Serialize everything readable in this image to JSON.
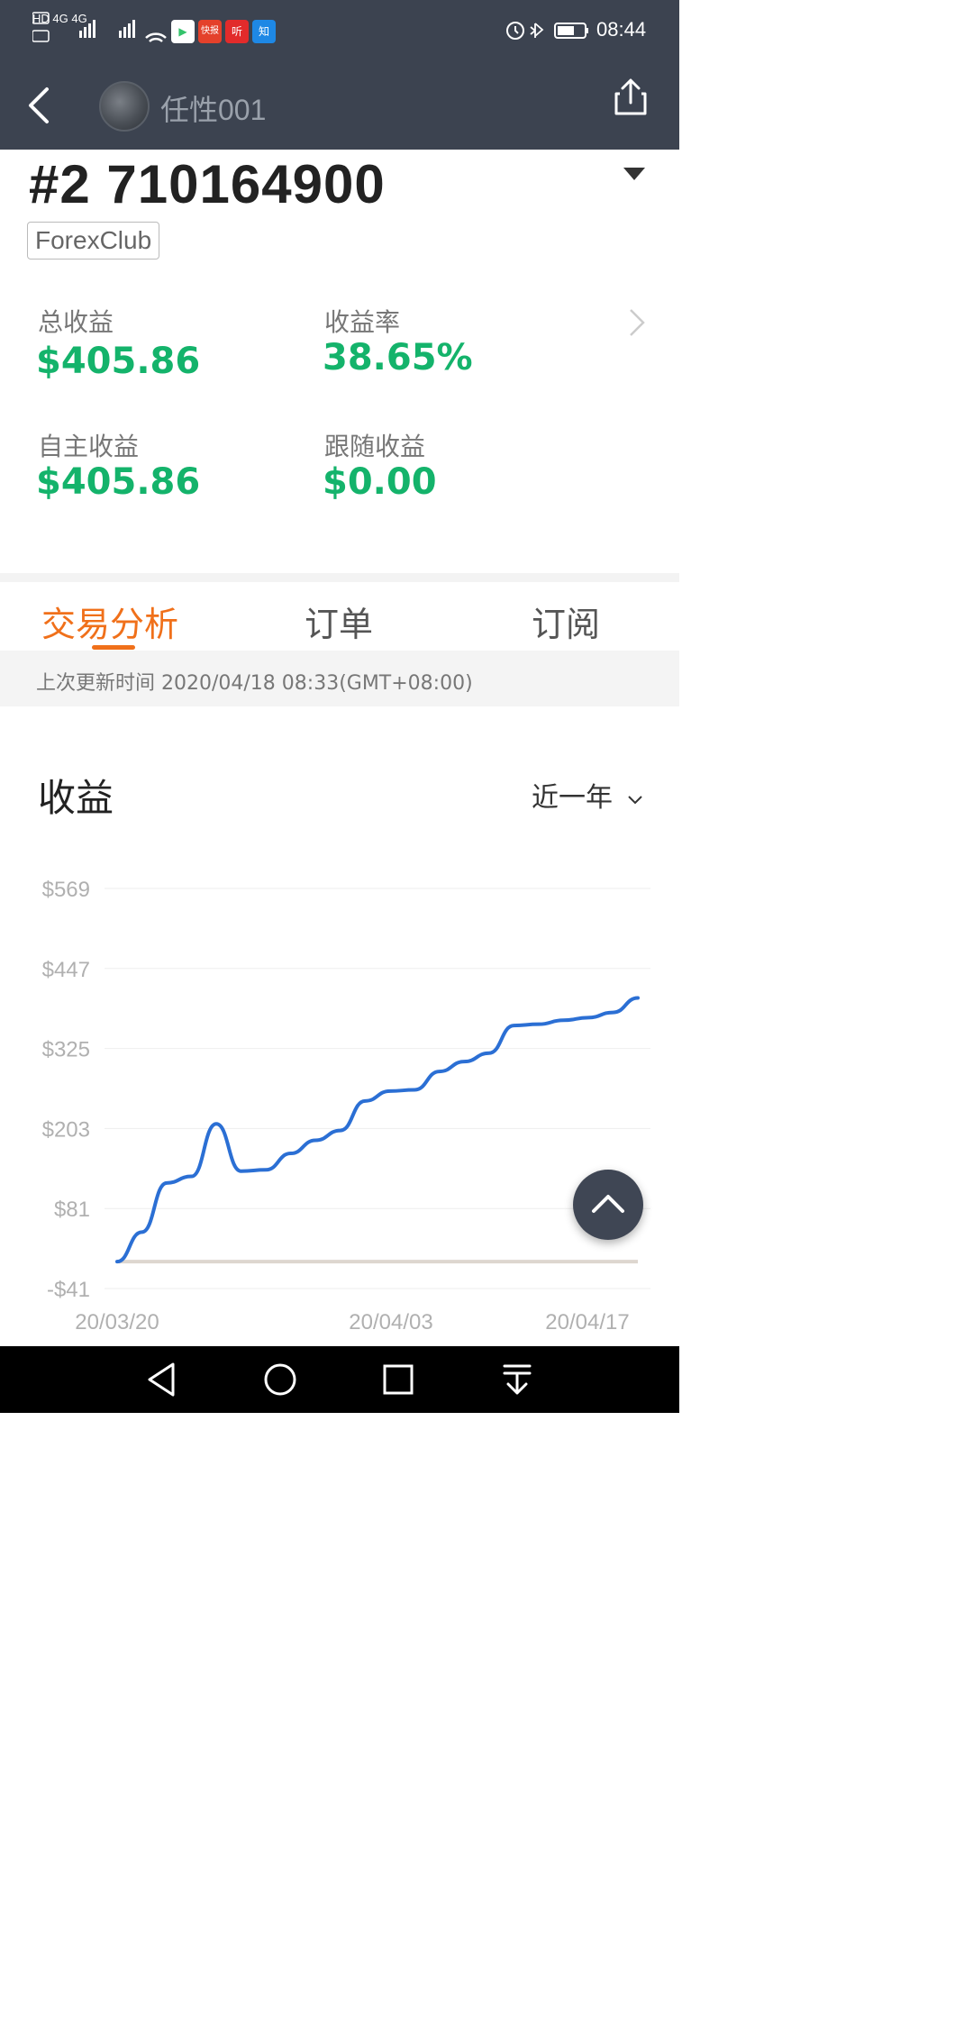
{
  "status_bar": {
    "network": "HD 4G 4G",
    "apps": [
      {
        "name": "video-app-icon",
        "label": "▶",
        "color": "#34c36b"
      },
      {
        "name": "kuaibao-app-icon",
        "label": "快报",
        "color": "#e4412b"
      },
      {
        "name": "ting-app-icon",
        "label": "听",
        "color": "#e22b2b"
      },
      {
        "name": "zhihu-app-icon",
        "label": "知",
        "color": "#1e88e5"
      }
    ],
    "time": "08:44"
  },
  "header": {
    "username": "任性001"
  },
  "account": {
    "id": "#2 710164900",
    "broker": "ForexClub"
  },
  "stats": {
    "total_profit_label": "总收益",
    "total_profit_value": "$405.86",
    "return_rate_label": "收益率",
    "return_rate_value": "38.65%",
    "self_profit_label": "自主收益",
    "self_profit_value": "$405.86",
    "follow_profit_label": "跟随收益",
    "follow_profit_value": "$0.00"
  },
  "tabs": [
    {
      "label": "交易分析",
      "active": true
    },
    {
      "label": "订单",
      "active": false
    },
    {
      "label": "订阅",
      "active": false
    }
  ],
  "last_update": "上次更新时间 2020/04/18 08:33(GMT+08:00)",
  "section": {
    "title": "收益",
    "range": "近一年"
  },
  "colors": {
    "header_bg": "#3c4350",
    "accent": "#f0701a",
    "profit_green": "#14b36b",
    "line_blue": "#2b6fd4"
  },
  "chart_data": {
    "type": "line",
    "ylabel": "",
    "xlabel": "",
    "y_ticks": [
      "$569",
      "$447",
      "$325",
      "$203",
      "$81",
      "-$41"
    ],
    "y_tick_values": [
      569,
      447,
      325,
      203,
      81,
      -41
    ],
    "x_ticks": [
      "20/03/20",
      "20/04/03",
      "20/04/17"
    ],
    "ylim": [
      -41,
      569
    ],
    "grid": true,
    "series": [
      {
        "values": [
          {
            "x": "2020-03-20",
            "y": 0
          },
          {
            "x": "2020-03-21",
            "y": 45
          },
          {
            "x": "2020-03-22",
            "y": 120
          },
          {
            "x": "2020-03-23",
            "y": 130
          },
          {
            "x": "2020-03-24",
            "y": 210
          },
          {
            "x": "2020-03-25",
            "y": 138
          },
          {
            "x": "2020-03-26",
            "y": 140
          },
          {
            "x": "2020-03-27",
            "y": 165
          },
          {
            "x": "2020-03-28",
            "y": 185
          },
          {
            "x": "2020-03-29",
            "y": 200
          },
          {
            "x": "2020-03-30",
            "y": 245
          },
          {
            "x": "2020-03-31",
            "y": 260
          },
          {
            "x": "2020-04-01",
            "y": 262
          },
          {
            "x": "2020-04-02",
            "y": 290
          },
          {
            "x": "2020-04-03",
            "y": 305
          },
          {
            "x": "2020-04-04",
            "y": 318
          },
          {
            "x": "2020-04-05",
            "y": 360
          },
          {
            "x": "2020-04-06",
            "y": 362
          },
          {
            "x": "2020-04-07",
            "y": 368
          },
          {
            "x": "2020-04-08",
            "y": 372
          },
          {
            "x": "2020-04-09",
            "y": 380
          },
          {
            "x": "2020-04-10",
            "y": 402
          }
        ]
      },
      {
        "values": [
          {
            "x": "2020-03-20",
            "y": 0
          },
          {
            "x": "2020-04-10",
            "y": 0
          }
        ]
      }
    ]
  }
}
